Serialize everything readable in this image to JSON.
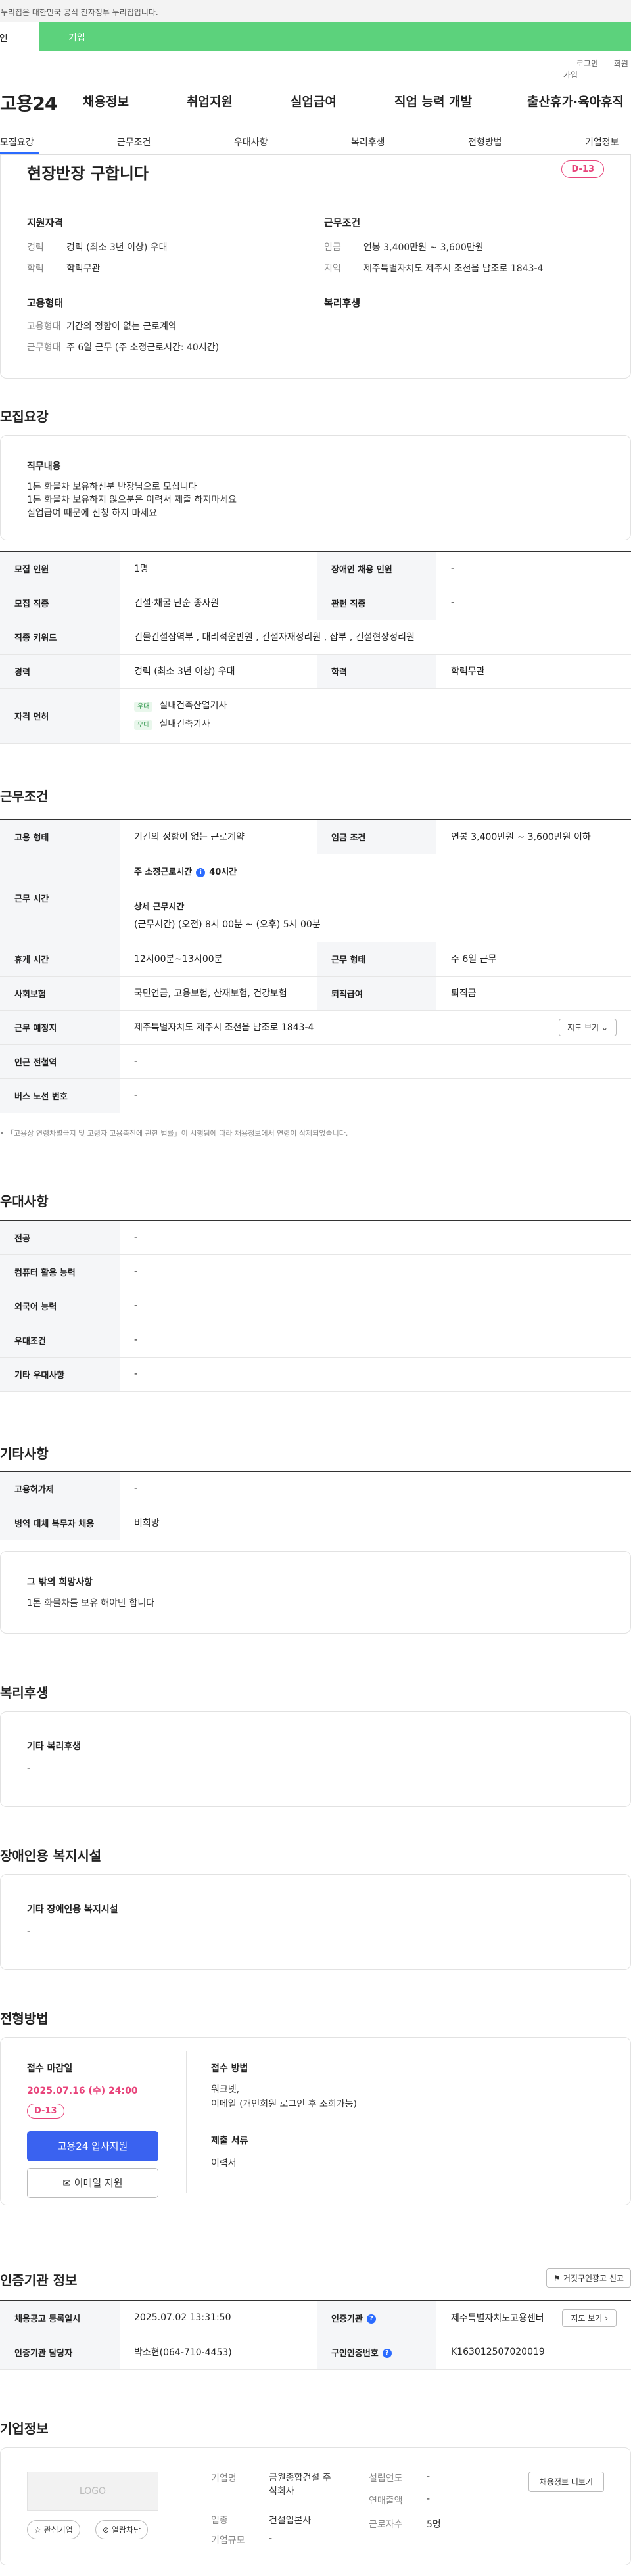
{
  "banner": {
    "text": "이 누리집은 대한민국 공식 전자정부 누리집입니다."
  },
  "user_tabs": {
    "person": "개인",
    "company": "기업"
  },
  "util": {
    "login": "로그인",
    "join": "회원가입"
  },
  "nav": {
    "logo": "고용24",
    "items": [
      "채용정보",
      "취업지원",
      "실업급여",
      "직업 능력 개발",
      "출산휴가·육아휴직"
    ]
  },
  "sub_tabs": [
    "모집요강",
    "근무조건",
    "우대사항",
    "복리후생",
    "전형방법",
    "기업정보"
  ],
  "summary": {
    "title": "현장반장 구합니다",
    "dday": "D-13",
    "qual_h": "지원자격",
    "work_h": "근무조건",
    "emp_h": "고용형태",
    "welfare_h": "복리후생",
    "career_k": "경력",
    "career_v": "경력 (최소 3년 이상) 우대",
    "edu_k": "학력",
    "edu_v": "학력무관",
    "pay_k": "임금",
    "pay_v": "연봉 3,400만원 ~ 3,600만원",
    "loc_k": "지역",
    "loc_v": "제주특별자치도 제주시 조천읍 남조로 1843-4",
    "emptype_k": "고용형태",
    "emptype_v": "기간의 정함이 없는 근로계약",
    "worktype_k": "근무형태",
    "worktype_v": "주 6일 근무 (주 소정근로시간: 40시간)"
  },
  "recruit": {
    "title": "모집요강",
    "duty_h": "직무내용",
    "duty_lines": [
      "1톤 화물차 보유하신분 반장님으로 모십니다",
      "1톤 화물차 보유하지 않으분은 이력서 제출 하지마세요",
      "실업급여 때문에 신청 하지 마세요"
    ],
    "rows": {
      "count_k": "모집 인원",
      "count_v": "1명",
      "disabled_k": "장애인 채용 인원",
      "disabled_v": "-",
      "job_k": "모집 직종",
      "job_v": "건설·채굴 단순 종사원",
      "related_k": "관련 직종",
      "related_v": "-",
      "keyword_k": "직종 키워드",
      "keyword_v": "건물건설잡역부 , 대리석운반원 , 건설자재정리원 , 잡부 , 건설현장정리원",
      "career_k": "경력",
      "career_v": "경력 (최소 3년 이상) 우대",
      "edu_k": "학력",
      "edu_v": "학력무관",
      "license_k": "자격 면허",
      "licenses": [
        {
          "tag": "우대",
          "name": "실내건축산업기사"
        },
        {
          "tag": "우대",
          "name": "실내건축기사"
        }
      ]
    }
  },
  "condition": {
    "title": "근무조건",
    "emptype_k": "고용 형태",
    "emptype_v": "기간의 정함이 없는 근로계약",
    "pay_k": "임금 조건",
    "pay_v": "연봉 3,400만원 ~ 3,600만원 이하",
    "hours_k": "근무 시간",
    "hours_l1a": "주 소정근로시간",
    "hours_l1b": "40시간",
    "hours_l2": "상세 근무시간",
    "hours_l3": "(근무시간) (오전) 8시 00분 ~ (오후) 5시 00분",
    "rest_k": "휴게 시간",
    "rest_v": "12시00분~13시00분",
    "shift_k": "근무 형태",
    "shift_v": "주 6일 근무",
    "ins_k": "사회보험",
    "ins_v": "국민연금, 고용보험, 산재보험, 건강보험",
    "retire_k": "퇴직급여",
    "retire_v": "퇴직금",
    "place_k": "근무 예정지",
    "place_v": "제주특별자치도 제주시 조천읍 남조로 1843-4",
    "map_btn": "지도 보기",
    "subway_k": "인근 전철역",
    "subway_v": "-",
    "bus_k": "버스 노선 번호",
    "bus_v": "-",
    "note": "「고용상 연령차별금지 및 고령자 고용촉진에 관한 법률」이 시행됨에 따라 채용정보에서 연령이 삭제되었습니다."
  },
  "pref": {
    "title": "우대사항",
    "major_k": "전공",
    "major_v": "-",
    "pc_k": "컴퓨터 활용 능력",
    "pc_v": "-",
    "lang_k": "외국어 능력",
    "lang_v": "-",
    "cond_k": "우대조건",
    "cond_v": "-",
    "etc_k": "기타 우대사항",
    "etc_v": "-"
  },
  "etc": {
    "title": "기타사항",
    "insure_k": "고용허가제",
    "insure_v": "-",
    "military_k": "병역 대체 복무자 채용",
    "military_v": "비희망",
    "other_h": "그 밖의 희망사항",
    "other_v": "1톤 화물차를 보유 해야만 합니다"
  },
  "welfare": {
    "title": "복리후생",
    "h": "기타 복리후생",
    "v": "-"
  },
  "facility": {
    "title": "장애인용 복지시설",
    "h": "기타 장애인용 복지시설",
    "v": "-"
  },
  "selection": {
    "title": "전형방법",
    "deadline_h": "접수 마감일",
    "deadline_v": "2025.07.16 (수) 24:00",
    "dday": "D-13",
    "apply_btn": "고용24 입사지원",
    "email_btn": "이메일 지원",
    "method_h": "접수 방법",
    "method_v1": "워크넷,",
    "method_v2": "이메일 (개인회원 로그인 후 조회가능)",
    "docs_h": "제출 서류",
    "docs_v": "이력서"
  },
  "cert": {
    "title": "인증기관 정보",
    "report_btn": "거짓구인광고 신고",
    "date_k": "채용공고 등록일시",
    "date_v": "2025.07.02 13:31:50",
    "org_k": "인증기관",
    "org_v": "제주특별자치도고용센터",
    "map_btn": "지도 보기",
    "mgr_k": "인증기관 담당자",
    "mgr_v": "박소현(064-710-4453)",
    "no_k": "구인인증번호",
    "no_v": "K163012507020019"
  },
  "company": {
    "title": "기업정보",
    "logo": "LOGO",
    "fav_btn": "관심기업",
    "block_btn": "열람차단",
    "name_k": "기업명",
    "name_v1": "금원종합건설 주",
    "name_v2": "식회사",
    "founded_k": "설립연도",
    "founded_v": "-",
    "sales_k": "연매출액",
    "sales_v": "-",
    "industry_k": "업종",
    "industry_v": "건설업본사",
    "emp_k": "근로자수",
    "emp_v": "5명",
    "size_k": "기업규모",
    "size_v": "-",
    "jobs_btn": "채용정보 더보기"
  }
}
